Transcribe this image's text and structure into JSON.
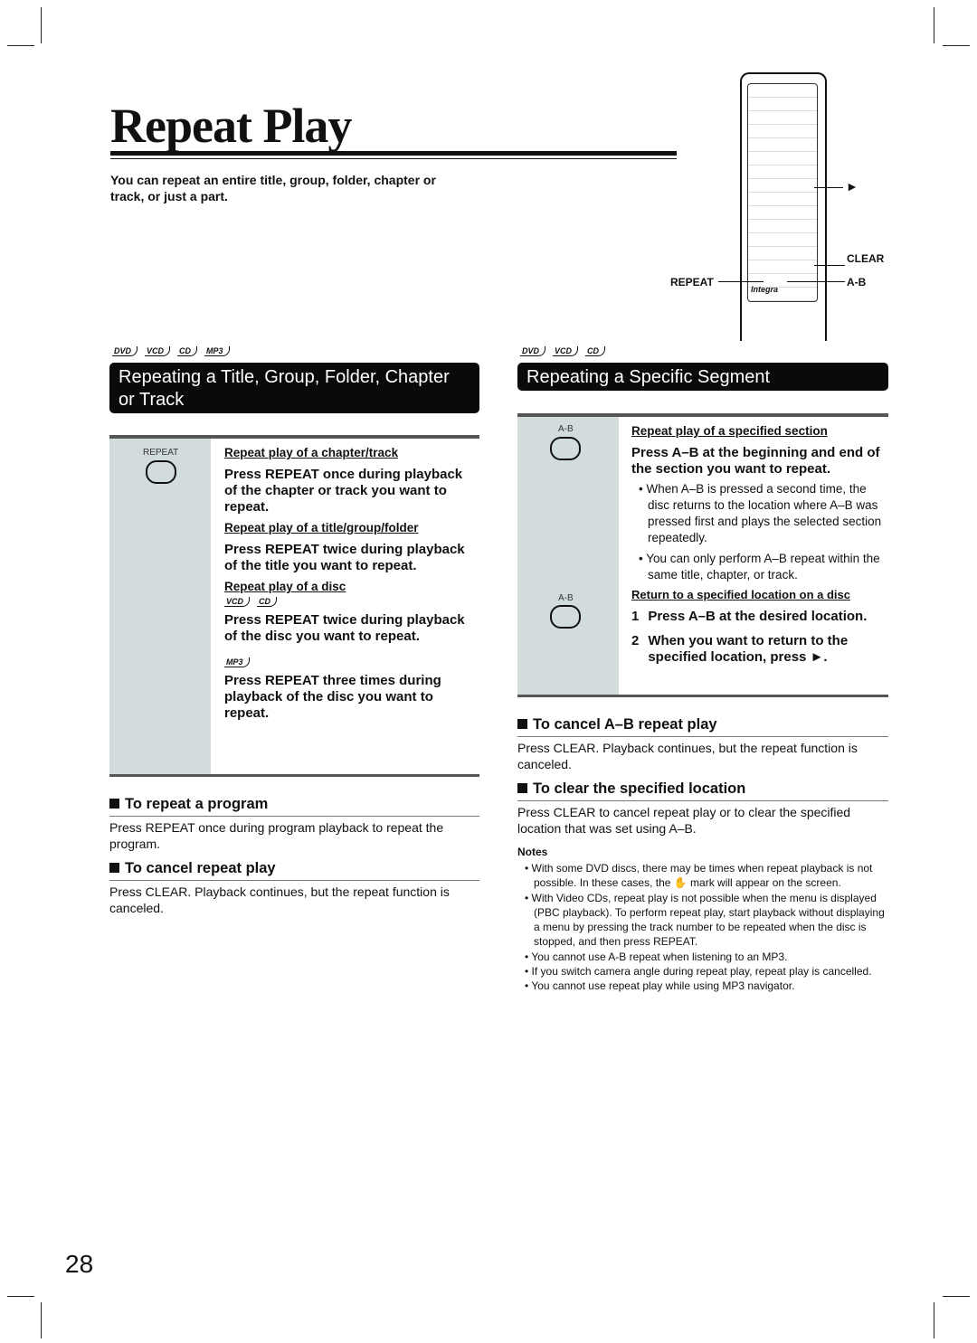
{
  "title": "Repeat Play",
  "intro": "You can repeat an entire title, group, folder, chapter or track, or just a part.",
  "remote": {
    "brand": "Integra",
    "callouts": {
      "play": "►",
      "clear": "CLEAR",
      "repeat": "REPEAT",
      "ab": "A-B"
    }
  },
  "left": {
    "logos": [
      "DVD",
      "VCD",
      "CD",
      "MP3"
    ],
    "header": "Repeating a Title, Group, Folder, Chapter or Track",
    "button_label": "REPEAT",
    "sub1": "Repeat play of a chapter/track",
    "step1": "Press REPEAT once during playback of the chapter or track you want to repeat.",
    "sub2": "Repeat play of a title/group/folder",
    "step2": "Press REPEAT twice during playback of the title you want to repeat.",
    "sub3": "Repeat play of a disc",
    "logos3": [
      "VCD",
      "CD"
    ],
    "step3": "Press REPEAT twice during playback of the disc you want to repeat.",
    "logos4": [
      "MP3"
    ],
    "step4": "Press REPEAT three times during playback of the disc you want to repeat.",
    "h_program": "To repeat a program",
    "program_text": "Press REPEAT once during program playback to repeat the program.",
    "h_cancel": "To cancel repeat play",
    "cancel_text": "Press CLEAR. Playback continues, but the repeat function is canceled."
  },
  "right": {
    "logos": [
      "DVD",
      "VCD",
      "CD"
    ],
    "header": "Repeating a Specific Segment",
    "button_label": "A-B",
    "sub1": "Repeat play of a specified section",
    "step1": "Press A–B at the beginning and end of the section you want to repeat.",
    "bullets1": [
      "When A–B is pressed a second time, the disc returns to the location where A–B was pressed first and plays the selected section repeatedly.",
      "You can only perform A–B repeat within the same title, chapter, or track."
    ],
    "sub2": "Return to a specified location on a disc",
    "steps2": [
      {
        "n": "1",
        "t": "Press A–B at the desired location."
      },
      {
        "n": "2",
        "t": "When you want to return to the specified location, press ►."
      }
    ],
    "h_cancel": "To cancel A–B repeat play",
    "cancel_text": "Press CLEAR. Playback continues, but the repeat function is canceled.",
    "h_clear": "To clear the specified location",
    "clear_text": "Press CLEAR to cancel repeat play or to clear the specified location that was set using A–B.",
    "notes_title": "Notes",
    "notes": [
      "With some DVD discs, there may be times when repeat playback is not possible. In these cases, the ✋ mark will appear on the screen.",
      "With Video CDs, repeat play is not possible when the menu is displayed (PBC playback). To perform repeat play, start playback without displaying a menu by pressing the track number to be repeated when the disc is stopped, and then press REPEAT.",
      "You cannot use A-B repeat when listening to an MP3.",
      "If you switch camera angle during repeat play, repeat play is cancelled.",
      "You cannot use repeat play while using MP3 navigator."
    ]
  },
  "page_number": "28"
}
